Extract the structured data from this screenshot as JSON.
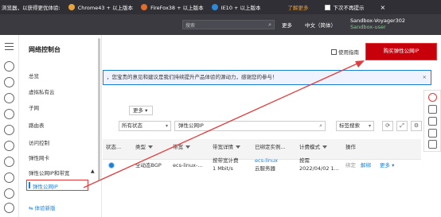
{
  "notice_bar": {
    "text": "浏览器，以获得更优体验:",
    "browsers": [
      {
        "label": "Chrome43 + 以上版本",
        "color": "#e8a43c"
      },
      {
        "label": "FireFox38 + 以上版本",
        "color": "#e06b2a"
      },
      {
        "label": "IE10 + 以上版本",
        "color": "#2d89d6"
      }
    ],
    "learn_more": "了解更多",
    "no_more": "下次不再提示",
    "close": "×"
  },
  "header": {
    "search_placeholder": "搜索",
    "more": "更多",
    "language": "中文（简体）",
    "account": "Sandbox-Voyager302",
    "user": "Sandbox-user"
  },
  "rail_icons": [
    "menu-icon",
    "cloud-icon",
    "server-icon",
    "cloud-icon",
    "database-icon",
    "cloud-icon",
    "network-icon",
    "cloud-icon",
    "shield-icon",
    "cloud-icon",
    "chart-icon",
    "cloud-icon"
  ],
  "sidenav": {
    "title": "网络控制台",
    "items": [
      "总览",
      "虚拟私有云",
      "子网",
      "路由表",
      "访问控制",
      "弹性网卡"
    ],
    "group": "弹性公网IP和带宽",
    "group_arrow": "▲",
    "active_item": "弹性公网IP",
    "old_version": "体验新版"
  },
  "toolbar": {
    "manual": "使用指南",
    "buy_button": "购买弹性公网IP"
  },
  "banner": {
    "text": "，您宝贵的意见和建议是我们持续提升产品体验的源动力，感谢您的参与！",
    "close": "×"
  },
  "filters": {
    "more_button": "更多",
    "more_arrow": "▾",
    "status": "所有状态",
    "status_arrow": "▾",
    "filter_placeholder": "弹性公网IP",
    "tag_search": "标签搜索",
    "tag_arrow": "▾"
  },
  "table": {
    "headers": [
      "状态...",
      "类型",
      "带宽",
      "带宽详情",
      "已绑定实例...",
      "计费模式",
      "操作"
    ],
    "row": {
      "type": "全动态BGP",
      "bandwidth": "ecs-linux-...",
      "bw_detail_1": "按带宽计费",
      "bw_detail_2": "1 Mbit/s",
      "instance": "ecs-linux",
      "instance_type": "云服务器",
      "billing_1": "按需",
      "billing_2": "2022/04/02 1...",
      "op_bind": "绑定",
      "op_unbind": "解绑",
      "op_more": "更多 ▾"
    }
  },
  "colors": {
    "accent": "#c7000b",
    "link": "#1b7fd6",
    "annotation": "#e43c3c"
  }
}
